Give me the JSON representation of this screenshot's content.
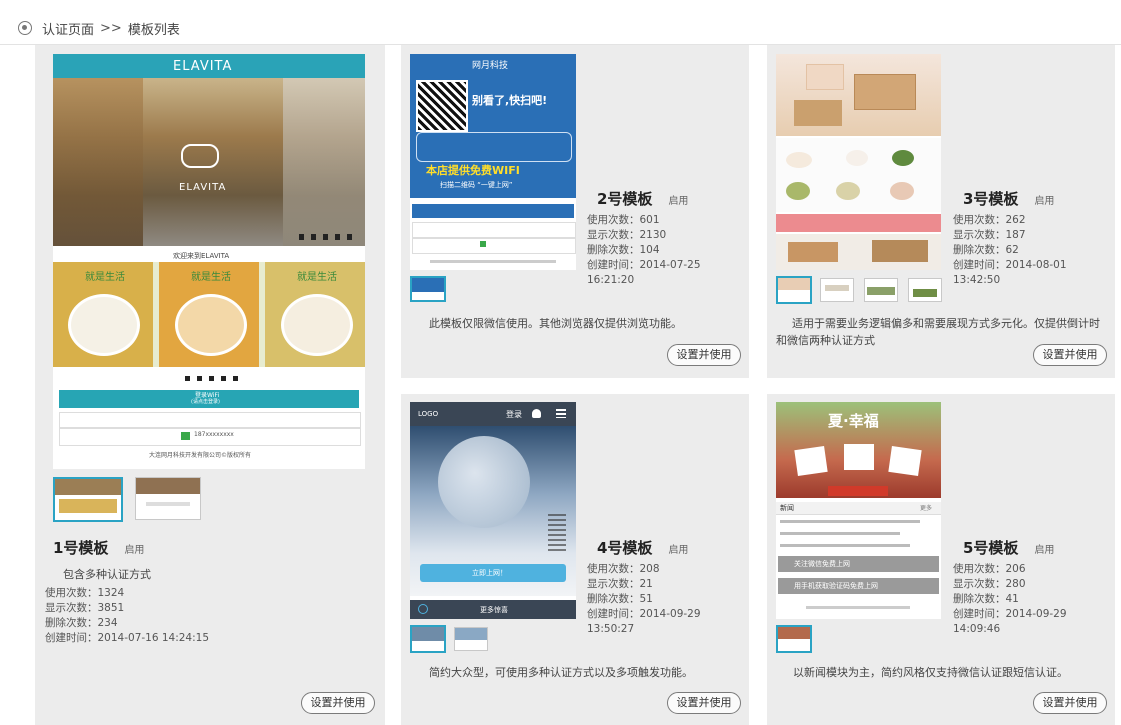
{
  "breadcrumb": {
    "root": "认证页面",
    "separator": ">>",
    "current": "模板列表"
  },
  "action_label": "设置并使用",
  "templates": [
    {
      "name": "1号模板",
      "status": "启用",
      "subtitle": "包含多种认证方式",
      "uses": "使用次数：1324",
      "shows": "显示次数：3851",
      "deletes": "删除次数：234",
      "created": "创建时间：2014-07-16 14:24:15",
      "preview": {
        "brand": "ELAVITA",
        "welcome": "欢迎来到ELAVITA",
        "banner": "就是生活",
        "login": "登录WiFi",
        "login_sub": "(请点击登录)",
        "phone": "187xxxxxxxx",
        "footer": "大连网月科技开发有限公司©版权所有"
      }
    },
    {
      "name": "2号模板",
      "status": "启用",
      "uses": "使用次数：601",
      "shows": "显示次数：2130",
      "deletes": "删除次数：104",
      "created": "创建时间：2014-07-25 16:21:20",
      "description": "此模板仅限微信使用。其他浏览器仅提供浏览功能。",
      "preview": {
        "brand": "网月科技",
        "scan": "别看了,快扫吧!",
        "wifi": "本店提供免费WIFI",
        "wifi_sub": "扫描二维码 “一键上网”"
      }
    },
    {
      "name": "3号模板",
      "status": "启用",
      "uses": "使用次数：262",
      "shows": "显示次数：187",
      "deletes": "删除次数：62",
      "created": "创建时间：2014-08-01 13:42:50",
      "description": "适用于需要业务逻辑偏多和需要展现方式多元化。仅提供倒计时和微信两种认证方式"
    },
    {
      "name": "4号模板",
      "status": "启用",
      "uses": "使用次数：208",
      "shows": "显示次数：21",
      "deletes": "删除次数：51",
      "created": "创建时间：2014-09-29 13:50:27",
      "description": "简约大众型，可使用多种认证方式以及多项触发功能。",
      "preview": {
        "logo": "LOGO",
        "login": "登录",
        "cta": "立即上网！",
        "more": "更多惊喜"
      }
    },
    {
      "name": "5号模板",
      "status": "启用",
      "uses": "使用次数：206",
      "shows": "显示次数：280",
      "deletes": "删除次数：41",
      "created": "创建时间：2014-09-29 14:09:46",
      "description": "以新闻模块为主，简约风格仅支持微信认证跟短信认证。",
      "preview": {
        "headline": "夏·幸福",
        "news": "新闻",
        "more": "更多",
        "wechat": "关注微信免费上网",
        "sms": "用手机获取验证码免费上网"
      }
    }
  ],
  "colors": {
    "card": "#ececec",
    "teal": "#2aa3c4",
    "qr_blue": "#2a6fb6"
  }
}
